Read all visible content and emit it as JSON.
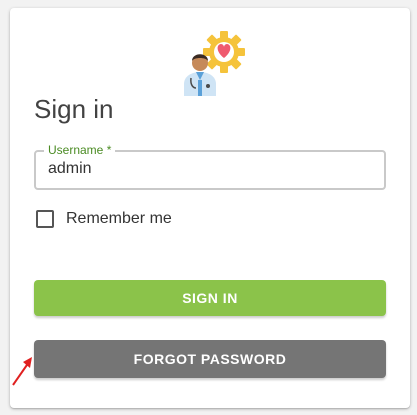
{
  "form": {
    "title": "Sign in",
    "username": {
      "label": "Username *",
      "value": "admin"
    },
    "remember_label": "Remember me",
    "signin_label": "SIGN IN",
    "forgot_label": "FORGOT PASSWORD"
  },
  "colors": {
    "accent": "#8bc34a",
    "secondary_button": "#757575",
    "label_green": "#4a8b23",
    "annotation_arrow": "#e02020"
  },
  "icons": {
    "logo": "doctor-gear-heart-icon",
    "annotation": "red-arrow-icon"
  }
}
